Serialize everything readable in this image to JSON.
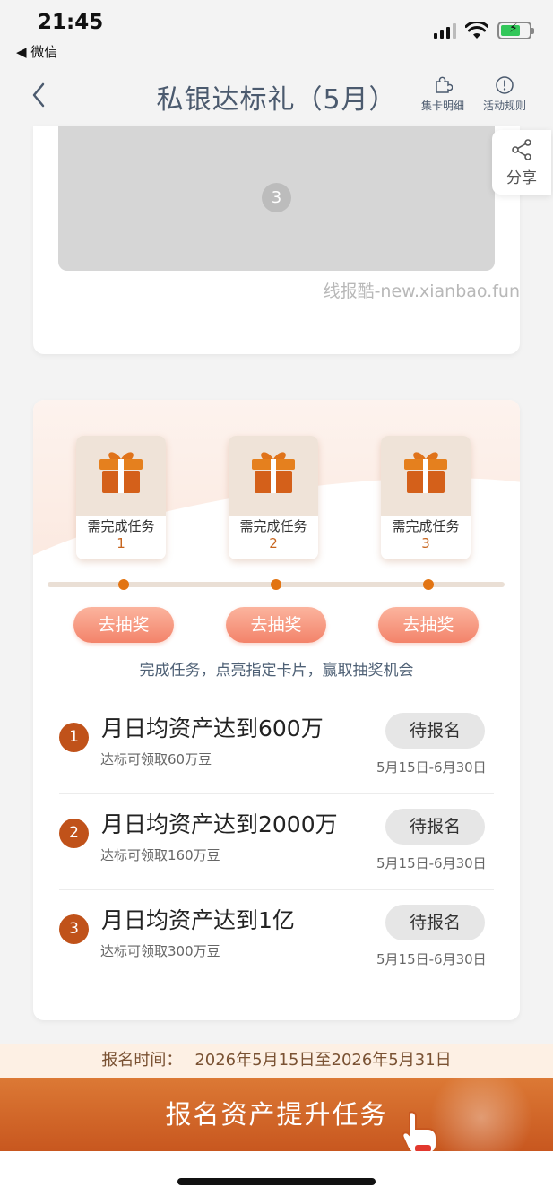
{
  "status_bar": {
    "time": "21:45",
    "back_app": "◀ 微信"
  },
  "nav": {
    "title": "私银达标礼（5月）",
    "actions": [
      {
        "label": "集卡明细",
        "icon": "puzzle-icon"
      },
      {
        "label": "活动规则",
        "icon": "info-icon"
      }
    ]
  },
  "banner": {
    "index": "3",
    "watermark": "线报酷-new.xianbao.fun"
  },
  "share": {
    "label": "分享",
    "icon": "share-icon"
  },
  "gifts": [
    {
      "label": "需完成任务",
      "num": "1",
      "button": "去抽奖"
    },
    {
      "label": "需完成任务",
      "num": "2",
      "button": "去抽奖"
    },
    {
      "label": "需完成任务",
      "num": "3",
      "button": "去抽奖"
    }
  ],
  "hint": "完成任务，点亮指定卡片，赢取抽奖机会",
  "tasks": [
    {
      "num": "1",
      "title": "月日均资产达到600万",
      "sub": "达标可领取60万豆",
      "button": "待报名",
      "date": "5月15日-6月30日"
    },
    {
      "num": "2",
      "title": "月日均资产达到2000万",
      "sub": "达标可领取160万豆",
      "button": "待报名",
      "date": "5月15日-6月30日"
    },
    {
      "num": "3",
      "title": "月日均资产达到1亿",
      "sub": "达标可领取300万豆",
      "button": "待报名",
      "date": "5月15日-6月30日"
    }
  ],
  "footer": {
    "reg_label": "报名时间：",
    "reg_value": "2026年5月15日至2026年5月31日",
    "button": "报名资产提升任务"
  },
  "colors": {
    "accent": "#e27412",
    "task_number": "#c0521a",
    "draw_button": "#f3836a",
    "footer_button": "#c8571f"
  }
}
